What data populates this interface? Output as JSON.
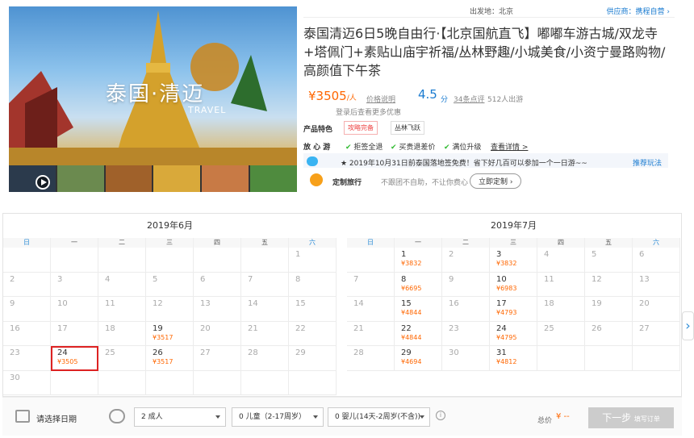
{
  "topbar": {
    "departure": "出发地：北京",
    "supplier": "供应商：携程自营 ›"
  },
  "hero": {
    "title": "泰国·清迈",
    "subtitle": "TRAVEL"
  },
  "product": {
    "title": "泰国清迈6日5晚自由行·【北京国航直飞】嘟嘟车游古城/双龙寺+塔佩门+素贴山庙宇祈福/丛林野趣/小城美食/小资宁曼路购物/高颜值下午茶",
    "price": "¥3505",
    "price_unit": "/人",
    "price_note": "价格说明",
    "login_tip": "登录后查看更多优惠",
    "score": "4.5",
    "score_unit": "分",
    "reviews": "34条点评",
    "trips": "512人出游",
    "features_label": "产品特色",
    "feature_tags": [
      "攻略完备",
      "丛林飞跃"
    ],
    "assurance_label": "放 心 游",
    "assurances": [
      "拒签全退",
      "买贵退差价",
      "满位升级"
    ],
    "assurance_link": "查看详情 >",
    "promo": "★ 2019年10月31日前泰国落地签免费！省下好几百可以参加一个一日游~~",
    "promo_link": "推荐玩法",
    "custom_label": "定制旅行",
    "custom_desc": "不跟团不自助，不让你费心",
    "custom_btn": "立即定制 ›"
  },
  "calendar": {
    "weekdays": [
      "日",
      "一",
      "二",
      "三",
      "四",
      "五",
      "六"
    ],
    "months": [
      {
        "title": "2019年6月",
        "cells": [
          {
            "d": "",
            "p": ""
          },
          {
            "d": "",
            "p": ""
          },
          {
            "d": "",
            "p": ""
          },
          {
            "d": "",
            "p": ""
          },
          {
            "d": "",
            "p": ""
          },
          {
            "d": "",
            "p": ""
          },
          {
            "d": "1",
            "p": ""
          },
          {
            "d": "2",
            "p": ""
          },
          {
            "d": "3",
            "p": ""
          },
          {
            "d": "4",
            "p": ""
          },
          {
            "d": "5",
            "p": ""
          },
          {
            "d": "6",
            "p": ""
          },
          {
            "d": "7",
            "p": ""
          },
          {
            "d": "8",
            "p": ""
          },
          {
            "d": "9",
            "p": ""
          },
          {
            "d": "10",
            "p": ""
          },
          {
            "d": "11",
            "p": ""
          },
          {
            "d": "12",
            "p": ""
          },
          {
            "d": "13",
            "p": ""
          },
          {
            "d": "14",
            "p": ""
          },
          {
            "d": "15",
            "p": ""
          },
          {
            "d": "16",
            "p": ""
          },
          {
            "d": "17",
            "p": ""
          },
          {
            "d": "18",
            "p": ""
          },
          {
            "d": "19",
            "p": "¥3517"
          },
          {
            "d": "20",
            "p": ""
          },
          {
            "d": "21",
            "p": ""
          },
          {
            "d": "22",
            "p": ""
          },
          {
            "d": "23",
            "p": ""
          },
          {
            "d": "24",
            "p": "¥3505",
            "sel": true
          },
          {
            "d": "25",
            "p": ""
          },
          {
            "d": "26",
            "p": "¥3517"
          },
          {
            "d": "27",
            "p": ""
          },
          {
            "d": "28",
            "p": ""
          },
          {
            "d": "29",
            "p": ""
          },
          {
            "d": "30",
            "p": ""
          },
          {
            "d": "",
            "p": ""
          },
          {
            "d": "",
            "p": ""
          },
          {
            "d": "",
            "p": ""
          },
          {
            "d": "",
            "p": ""
          },
          {
            "d": "",
            "p": ""
          },
          {
            "d": "",
            "p": ""
          }
        ]
      },
      {
        "title": "2019年7月",
        "cells": [
          {
            "d": "",
            "p": ""
          },
          {
            "d": "1",
            "p": "¥3832"
          },
          {
            "d": "2",
            "p": ""
          },
          {
            "d": "3",
            "p": "¥3832"
          },
          {
            "d": "4",
            "p": ""
          },
          {
            "d": "5",
            "p": ""
          },
          {
            "d": "6",
            "p": ""
          },
          {
            "d": "7",
            "p": ""
          },
          {
            "d": "8",
            "p": "¥6695"
          },
          {
            "d": "9",
            "p": ""
          },
          {
            "d": "10",
            "p": "¥6983"
          },
          {
            "d": "11",
            "p": ""
          },
          {
            "d": "12",
            "p": ""
          },
          {
            "d": "13",
            "p": ""
          },
          {
            "d": "14",
            "p": ""
          },
          {
            "d": "15",
            "p": "¥4844"
          },
          {
            "d": "16",
            "p": ""
          },
          {
            "d": "17",
            "p": "¥4793"
          },
          {
            "d": "18",
            "p": ""
          },
          {
            "d": "19",
            "p": ""
          },
          {
            "d": "20",
            "p": ""
          },
          {
            "d": "21",
            "p": ""
          },
          {
            "d": "22",
            "p": "¥4844"
          },
          {
            "d": "23",
            "p": ""
          },
          {
            "d": "24",
            "p": "¥4795"
          },
          {
            "d": "25",
            "p": ""
          },
          {
            "d": "26",
            "p": ""
          },
          {
            "d": "27",
            "p": ""
          },
          {
            "d": "28",
            "p": ""
          },
          {
            "d": "29",
            "p": "¥4694"
          },
          {
            "d": "30",
            "p": ""
          },
          {
            "d": "31",
            "p": "¥4812"
          },
          {
            "d": "",
            "p": ""
          },
          {
            "d": "",
            "p": ""
          },
          {
            "d": "",
            "p": ""
          }
        ]
      }
    ]
  },
  "booking": {
    "date_label": "请选择日期",
    "adults": "2  成人",
    "children": "0  儿童（2-17周岁）",
    "infants": "0  婴儿(14天-2周岁(不含))",
    "total_label": "总价",
    "total_value": "¥ --",
    "next_label": "下一步",
    "next_sub": "填写订单"
  },
  "colors": {
    "accent": "#f60",
    "link": "#1a7bd0",
    "selected": "#d22"
  }
}
